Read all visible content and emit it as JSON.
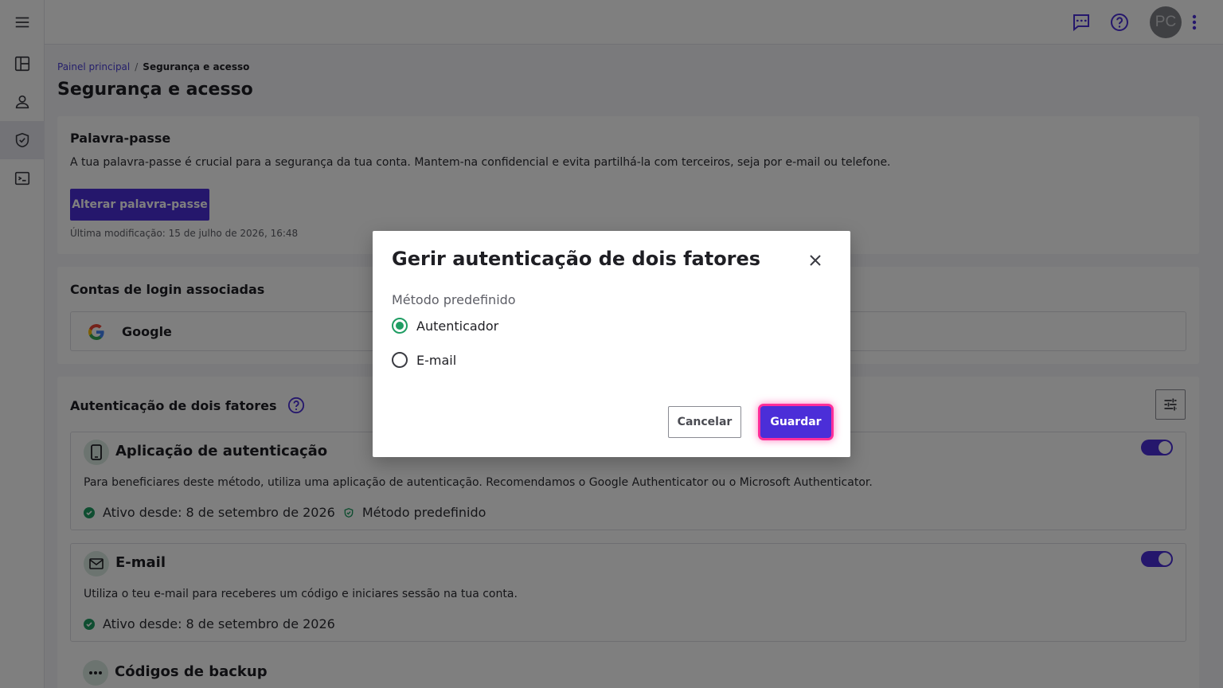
{
  "topbar": {
    "avatar_initials": "PC"
  },
  "breadcrumb": {
    "home": "Painel principal",
    "separator": "/",
    "current": "Segurança e acesso"
  },
  "page": {
    "title": "Segurança e acesso"
  },
  "password_card": {
    "title": "Palavra-passe",
    "description": "A tua palavra-passe é crucial para a segurança da tua conta. Mantem-na confidencial e evita partilhá-la com terceiros, seja por e-mail ou telefone.",
    "change_button": "Alterar palavra-passe",
    "last_modified": "Última modificação: 15 de julho de 2026, 16:48"
  },
  "linked_accounts": {
    "title": "Contas de login associadas",
    "providers": [
      {
        "name": "Google"
      }
    ]
  },
  "two_factor": {
    "title": "Autenticação de dois fatores",
    "methods": [
      {
        "title": "Aplicação de autenticação",
        "description": "Para beneficiares deste método, utiliza uma aplicação de autenticação. Recomendamos o Google Authenticator ou o Microsoft Authenticator.",
        "status": "Ativo desde: 8 de setembro de 2026",
        "default_badge": "Método predefinido",
        "enabled": true
      },
      {
        "title": "E-mail",
        "description": "Utiliza o teu e-mail para receberes um código e iniciares sessão na tua conta.",
        "status": "Ativo desde: 8 de setembro de 2026",
        "enabled": true
      },
      {
        "title": "Códigos de backup"
      }
    ]
  },
  "modal": {
    "title": "Gerir autenticação de dois fatores",
    "field_label": "Método predefinido",
    "options": [
      {
        "label": "Autenticador",
        "selected": true
      },
      {
        "label": "E-mail",
        "selected": false
      }
    ],
    "cancel_label": "Cancelar",
    "save_label": "Guardar"
  },
  "colors": {
    "accent": "#4b2ed8",
    "success": "#1f9d63",
    "focus_ring": "#ff2e9a"
  }
}
